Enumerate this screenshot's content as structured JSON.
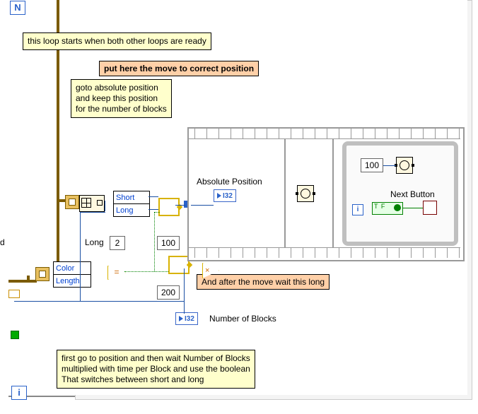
{
  "loop_iter_term": "N",
  "loop_idx_term": "i",
  "comments": {
    "loop_start": "this loop starts when both other loops are ready",
    "move_header": "put here the move to correct position",
    "goto": "goto absolute position\nand keep this position\nfor the number of blocks",
    "after_wait": "And after the move wait this long",
    "bottom": "first go to position and then wait Number of Blocks\nmultiplied with time per Block and use the boolean\nThat switches between short and long"
  },
  "unbundle1": {
    "items": [
      "Short",
      "Long"
    ]
  },
  "unbundle2": {
    "items": [
      "Color",
      "Length"
    ]
  },
  "length_label": "Long",
  "length_val": "2",
  "const100": "100",
  "const200": "200",
  "inner_const100": "100",
  "abs_pos_label": "Absolute Position",
  "abs_pos_type": "I32",
  "numblocks_label": "Number of Blocks",
  "numblocks_type": "I32",
  "next_button_label": "Next Button",
  "bool_tf": "T F"
}
